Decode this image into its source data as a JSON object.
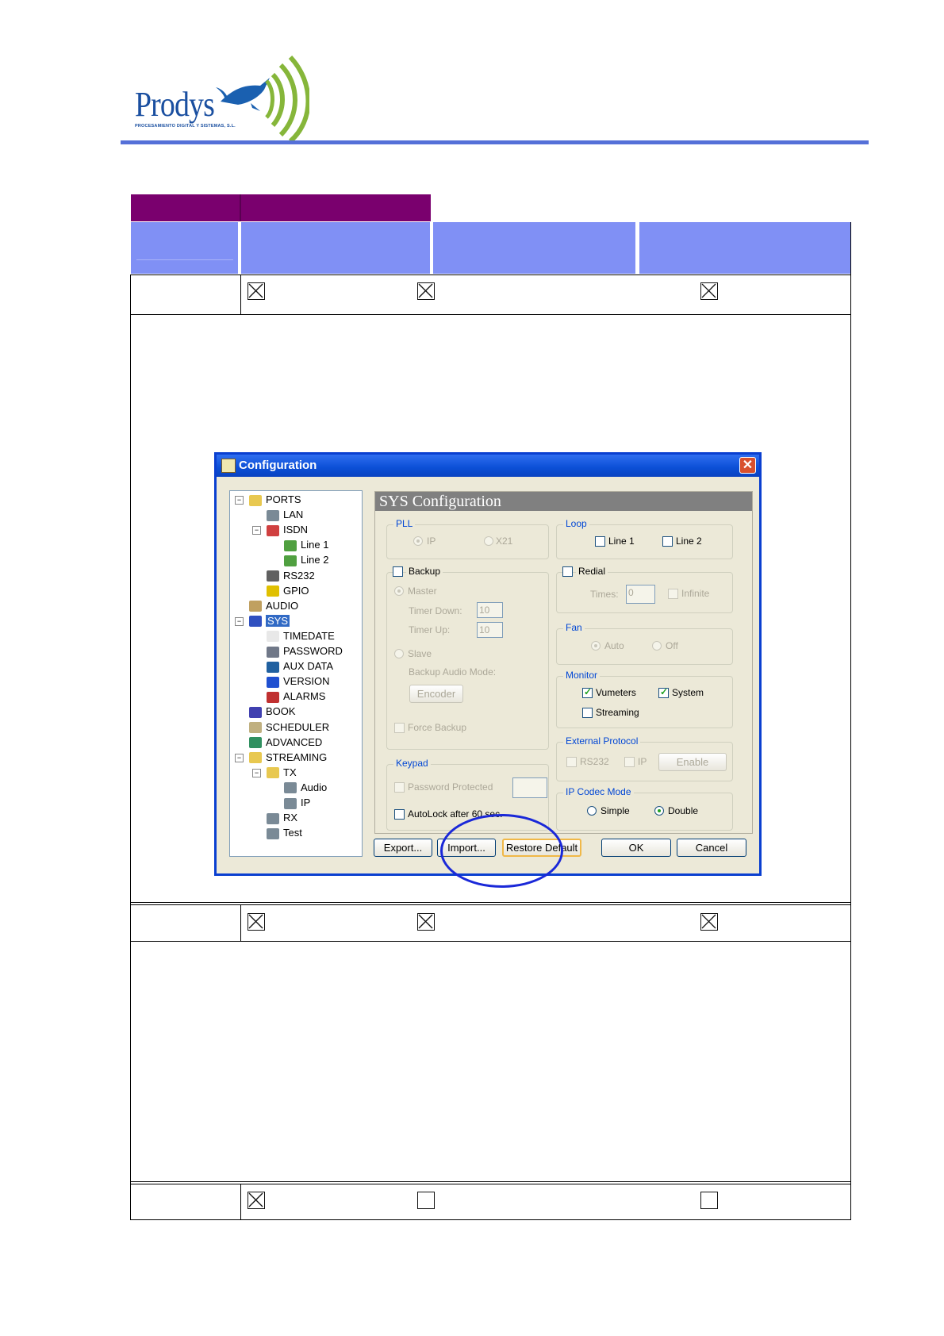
{
  "logo": {
    "brand": "Prodys",
    "tagline": "PROCESAMIENTO DIGITAL Y SISTEMAS, S.L."
  },
  "colors": {
    "header_rule": "#5570d8",
    "table_header_purple": "#7a006e",
    "table_header_blue": "#8090f5",
    "dialog_titlebar": "#0b4fd6",
    "highlight_ellipse": "#1a28d8"
  },
  "table": {
    "rows": [
      {
        "checkboxes": [
          "checked",
          "checked",
          "checked"
        ]
      },
      {
        "checkboxes": [
          "checked",
          "checked",
          "checked"
        ]
      },
      {
        "checkboxes": [
          "checked",
          "unchecked",
          "unchecked"
        ]
      }
    ]
  },
  "dialog": {
    "title": "Configuration",
    "close_icon": "close-icon",
    "tree": [
      {
        "label": "PORTS",
        "icon": "folder-icon"
      },
      {
        "label": "LAN",
        "icon": "network-icon"
      },
      {
        "label": "ISDN",
        "icon": "isdn-icon"
      },
      {
        "label": "Line 1",
        "icon": "line-icon"
      },
      {
        "label": "Line 2",
        "icon": "line-icon"
      },
      {
        "label": "RS232",
        "icon": "serial-icon"
      },
      {
        "label": "GPIO",
        "icon": "gpio-icon"
      },
      {
        "label": "AUDIO",
        "icon": "speaker-icon"
      },
      {
        "label": "SYS",
        "icon": "computer-icon"
      },
      {
        "label": "TIMEDATE",
        "icon": "clock-icon"
      },
      {
        "label": "PASSWORD",
        "icon": "key-icon"
      },
      {
        "label": "AUX DATA",
        "icon": "data-icon"
      },
      {
        "label": "VERSION",
        "icon": "help-icon"
      },
      {
        "label": "ALARMS",
        "icon": "alarm-icon"
      },
      {
        "label": "BOOK",
        "icon": "book-icon"
      },
      {
        "label": "SCHEDULER",
        "icon": "scheduler-icon"
      },
      {
        "label": "ADVANCED",
        "icon": "advanced-icon"
      },
      {
        "label": "STREAMING",
        "icon": "folder-icon"
      },
      {
        "label": "TX",
        "icon": "folder-icon"
      },
      {
        "label": "Audio",
        "icon": "network-icon"
      },
      {
        "label": "IP",
        "icon": "network-icon"
      },
      {
        "label": "RX",
        "icon": "network-icon"
      },
      {
        "label": "Test",
        "icon": "network-icon"
      }
    ],
    "panel_title": "SYS Configuration",
    "pll": {
      "label": "PLL",
      "ip": "IP",
      "x21": "X21"
    },
    "loop": {
      "label": "Loop",
      "line1": "Line 1",
      "line2": "Line 2"
    },
    "backup": {
      "label": "Backup",
      "master": "Master",
      "timer_down": "Timer Down:",
      "timer_down_value": "10",
      "timer_up": "Timer Up:",
      "timer_up_value": "10",
      "slave": "Slave",
      "audio_mode": "Backup Audio Mode:",
      "encoder": "Encoder",
      "force": "Force Backup"
    },
    "redial": {
      "label": "Redial",
      "times": "Times:",
      "times_value": "0",
      "infinite": "Infinite"
    },
    "fan": {
      "label": "Fan",
      "auto": "Auto",
      "off": "Off"
    },
    "monitor": {
      "label": "Monitor",
      "vumeters": "Vumeters",
      "system": "System",
      "streaming": "Streaming"
    },
    "external_protocol": {
      "label": "External Protocol",
      "rs232": "RS232",
      "ip": "IP",
      "enable": "Enable"
    },
    "keypad": {
      "label": "Keypad",
      "password": "Password Protected",
      "autolock": "AutoLock after 60 sec."
    },
    "ip_codec_mode": {
      "label": "IP Codec Mode",
      "simple": "Simple",
      "double": "Double"
    },
    "buttons": {
      "export": "Export...",
      "import": "Import...",
      "restore": "Restore Default",
      "ok": "OK",
      "cancel": "Cancel"
    }
  }
}
